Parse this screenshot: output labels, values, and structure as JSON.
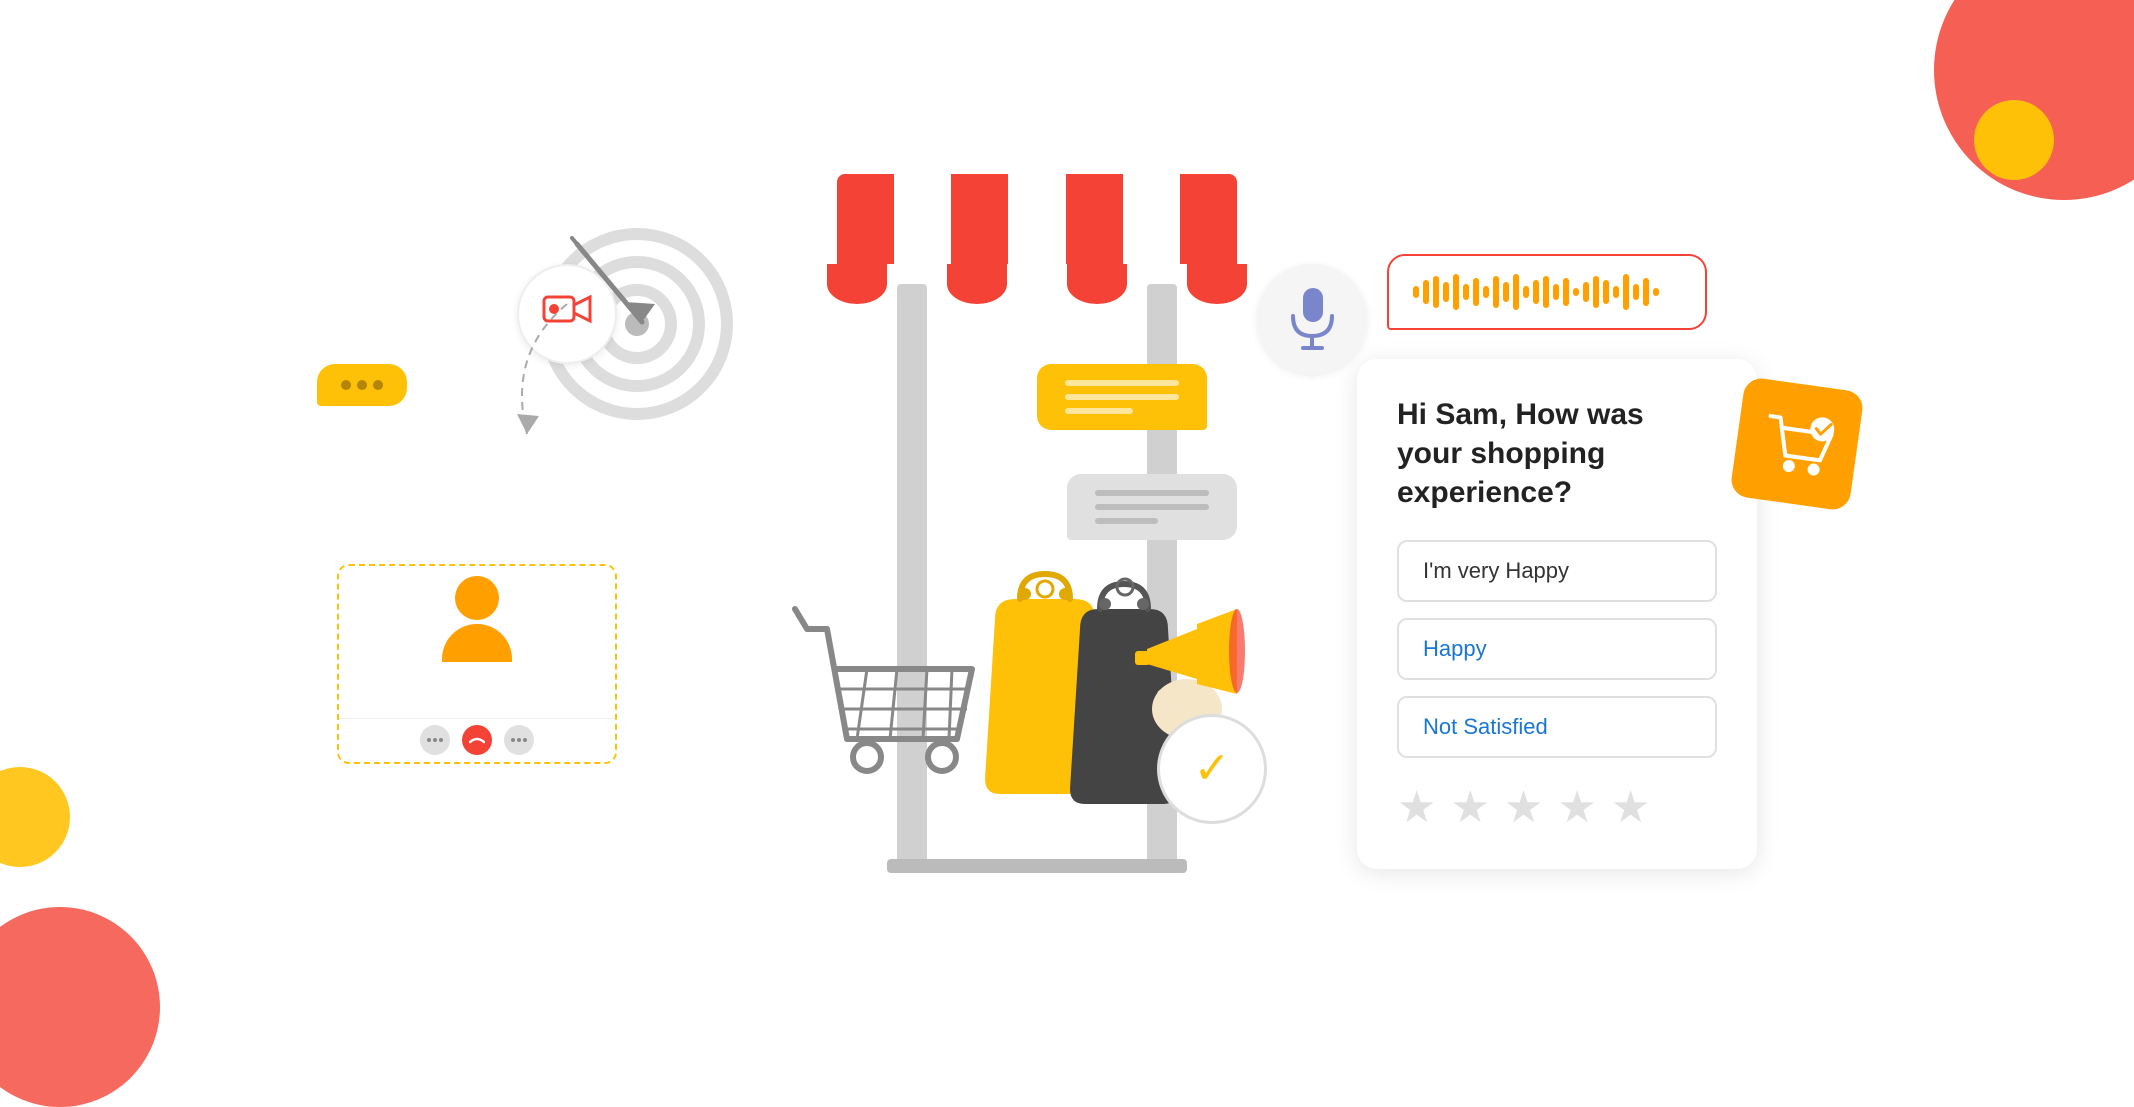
{
  "decorative": {
    "top_right_circle_color": "#f44336",
    "bottom_left_circle_color": "#f44336",
    "accent_yellow": "#FFC107",
    "accent_orange": "#FFA000"
  },
  "left": {
    "chat_bubble_dots": [
      "•",
      "•",
      "•"
    ],
    "video_icon": "📹",
    "avatar_label": "user-avatar"
  },
  "center": {
    "awning_stripes": 7,
    "check_icon": "✓"
  },
  "right": {
    "microphone_icon": "🎤",
    "audio_wave_label": "audio-waveform",
    "cart_icon": "🛒",
    "question": "Hi Sam, How was your shopping experience?",
    "options": [
      {
        "label": "I'm very Happy",
        "style": "default"
      },
      {
        "label": "Happy",
        "style": "blue"
      },
      {
        "label": "Not Satisfied",
        "style": "blue"
      }
    ],
    "stars_count": 5,
    "star_char": "★"
  }
}
